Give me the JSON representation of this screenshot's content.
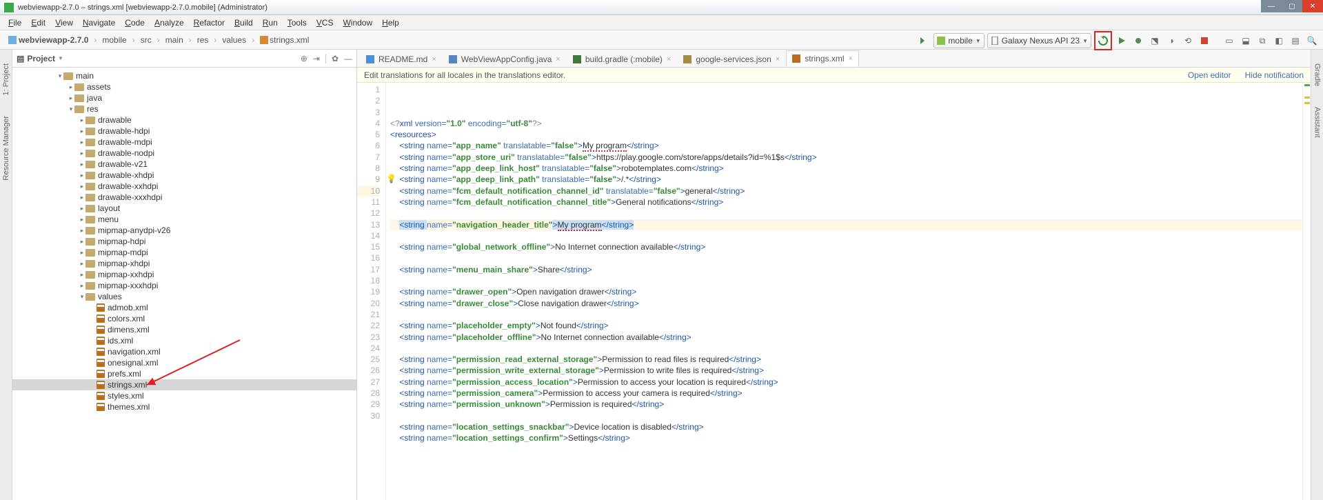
{
  "window": {
    "title": "webviewapp-2.7.0 – strings.xml [webviewapp-2.7.0.mobile] (Administrator)"
  },
  "menu": [
    "File",
    "Edit",
    "View",
    "Navigate",
    "Code",
    "Analyze",
    "Refactor",
    "Build",
    "Run",
    "Tools",
    "VCS",
    "Window",
    "Help"
  ],
  "breadcrumb": [
    "webviewapp-2.7.0",
    "mobile",
    "src",
    "main",
    "res",
    "values",
    "strings.xml"
  ],
  "run_config": {
    "module": "mobile",
    "device": "Galaxy Nexus API 23"
  },
  "project_header": {
    "label": "Project"
  },
  "tree": [
    {
      "d": 4,
      "tw": "▾",
      "k": "folder",
      "t": "main"
    },
    {
      "d": 5,
      "tw": "▸",
      "k": "folder",
      "t": "assets"
    },
    {
      "d": 5,
      "tw": "▸",
      "k": "folder",
      "t": "java"
    },
    {
      "d": 5,
      "tw": "▾",
      "k": "folder",
      "t": "res"
    },
    {
      "d": 6,
      "tw": "▸",
      "k": "folder",
      "t": "drawable"
    },
    {
      "d": 6,
      "tw": "▸",
      "k": "folder",
      "t": "drawable-hdpi"
    },
    {
      "d": 6,
      "tw": "▸",
      "k": "folder",
      "t": "drawable-mdpi"
    },
    {
      "d": 6,
      "tw": "▸",
      "k": "folder",
      "t": "drawable-nodpi"
    },
    {
      "d": 6,
      "tw": "▸",
      "k": "folder",
      "t": "drawable-v21"
    },
    {
      "d": 6,
      "tw": "▸",
      "k": "folder",
      "t": "drawable-xhdpi"
    },
    {
      "d": 6,
      "tw": "▸",
      "k": "folder",
      "t": "drawable-xxhdpi"
    },
    {
      "d": 6,
      "tw": "▸",
      "k": "folder",
      "t": "drawable-xxxhdpi"
    },
    {
      "d": 6,
      "tw": "▸",
      "k": "folder",
      "t": "layout"
    },
    {
      "d": 6,
      "tw": "▸",
      "k": "folder",
      "t": "menu"
    },
    {
      "d": 6,
      "tw": "▸",
      "k": "folder",
      "t": "mipmap-anydpi-v26"
    },
    {
      "d": 6,
      "tw": "▸",
      "k": "folder",
      "t": "mipmap-hdpi"
    },
    {
      "d": 6,
      "tw": "▸",
      "k": "folder",
      "t": "mipmap-mdpi"
    },
    {
      "d": 6,
      "tw": "▸",
      "k": "folder",
      "t": "mipmap-xhdpi"
    },
    {
      "d": 6,
      "tw": "▸",
      "k": "folder",
      "t": "mipmap-xxhdpi"
    },
    {
      "d": 6,
      "tw": "▸",
      "k": "folder",
      "t": "mipmap-xxxhdpi"
    },
    {
      "d": 6,
      "tw": "▾",
      "k": "folder",
      "t": "values"
    },
    {
      "d": 7,
      "tw": "",
      "k": "xml",
      "t": "admob.xml"
    },
    {
      "d": 7,
      "tw": "",
      "k": "xml",
      "t": "colors.xml"
    },
    {
      "d": 7,
      "tw": "",
      "k": "xml",
      "t": "dimens.xml"
    },
    {
      "d": 7,
      "tw": "",
      "k": "xml",
      "t": "ids.xml"
    },
    {
      "d": 7,
      "tw": "",
      "k": "xml",
      "t": "navigation.xml"
    },
    {
      "d": 7,
      "tw": "",
      "k": "xml",
      "t": "onesignal.xml"
    },
    {
      "d": 7,
      "tw": "",
      "k": "xml",
      "t": "prefs.xml"
    },
    {
      "d": 7,
      "tw": "",
      "k": "xml",
      "t": "strings.xml",
      "sel": true
    },
    {
      "d": 7,
      "tw": "",
      "k": "xml",
      "t": "styles.xml"
    },
    {
      "d": 7,
      "tw": "",
      "k": "xml",
      "t": "themes.xml"
    }
  ],
  "tabs": [
    {
      "icon": "md",
      "label": "README.md"
    },
    {
      "icon": "java",
      "label": "WebViewAppConfig.java"
    },
    {
      "icon": "gradle",
      "label": "build.gradle (:mobile)"
    },
    {
      "icon": "json",
      "label": "google-services.json"
    },
    {
      "icon": "xml",
      "label": "strings.xml",
      "active": true
    }
  ],
  "notice": {
    "text": "Edit translations for all locales in the translations editor.",
    "open": "Open editor",
    "hide": "Hide notification"
  },
  "code": {
    "lines": [
      {
        "n": 1,
        "seg": [
          [
            "decl",
            "<?"
          ],
          [
            "tag",
            "xml "
          ],
          [
            "attr",
            "version="
          ],
          [
            "val",
            "\"1.0\" "
          ],
          [
            "attr",
            "encoding="
          ],
          [
            "val",
            "\"utf-8\""
          ],
          [
            "decl",
            "?>"
          ]
        ]
      },
      {
        "n": 2,
        "seg": [
          [
            "tag",
            "<resources>"
          ]
        ]
      },
      {
        "n": 3,
        "seg": [
          [
            "txt",
            "    "
          ],
          [
            "tag",
            "<string "
          ],
          [
            "attr",
            "name="
          ],
          [
            "val",
            "\"app_name\" "
          ],
          [
            "attr",
            "translatable="
          ],
          [
            "val",
            "\"false\""
          ],
          [
            "tag",
            ">"
          ],
          [
            "err",
            "My program"
          ],
          [
            "tag",
            "</string>"
          ]
        ]
      },
      {
        "n": 4,
        "seg": [
          [
            "txt",
            "    "
          ],
          [
            "tag",
            "<string "
          ],
          [
            "attr",
            "name="
          ],
          [
            "val",
            "\"app_store_uri\" "
          ],
          [
            "attr",
            "translatable="
          ],
          [
            "val",
            "\"false\""
          ],
          [
            "tag",
            ">"
          ],
          [
            "txt",
            "https://play.google.com/store/apps/details?id=%1$s"
          ],
          [
            "tag",
            "</string>"
          ]
        ]
      },
      {
        "n": 5,
        "seg": [
          [
            "txt",
            "    "
          ],
          [
            "tag",
            "<string "
          ],
          [
            "attr",
            "name="
          ],
          [
            "val",
            "\"app_deep_link_host\" "
          ],
          [
            "attr",
            "translatable="
          ],
          [
            "val",
            "\"false\""
          ],
          [
            "tag",
            ">"
          ],
          [
            "txt",
            "robotemplates.com"
          ],
          [
            "tag",
            "</string>"
          ]
        ]
      },
      {
        "n": 6,
        "seg": [
          [
            "txt",
            "    "
          ],
          [
            "tag",
            "<string "
          ],
          [
            "attr",
            "name="
          ],
          [
            "val",
            "\"app_deep_link_path\" "
          ],
          [
            "attr",
            "translatable="
          ],
          [
            "val",
            "\"false\""
          ],
          [
            "tag",
            ">"
          ],
          [
            "txt",
            "/.*"
          ],
          [
            "tag",
            "</string>"
          ]
        ]
      },
      {
        "n": 7,
        "seg": [
          [
            "txt",
            "    "
          ],
          [
            "tag",
            "<string "
          ],
          [
            "attr",
            "name="
          ],
          [
            "val",
            "\"fcm_default_notification_channel_id\" "
          ],
          [
            "attr",
            "translatable="
          ],
          [
            "val",
            "\"false\""
          ],
          [
            "tag",
            ">"
          ],
          [
            "txt",
            "general"
          ],
          [
            "tag",
            "</string>"
          ]
        ]
      },
      {
        "n": 8,
        "seg": [
          [
            "txt",
            "    "
          ],
          [
            "tag",
            "<string "
          ],
          [
            "attr",
            "name="
          ],
          [
            "val",
            "\"fcm_default_notification_channel_title\""
          ],
          [
            "tag",
            ">"
          ],
          [
            "txt",
            "General notifications"
          ],
          [
            "tag",
            "</string>"
          ]
        ]
      },
      {
        "n": 9,
        "seg": []
      },
      {
        "n": 10,
        "hl": true,
        "seg": [
          [
            "txt",
            "    "
          ],
          [
            "seltag",
            "<string "
          ],
          [
            "attr",
            "name="
          ],
          [
            "val",
            "\"navigation_header_title\""
          ],
          [
            "seltag",
            ">"
          ],
          [
            "selerr",
            "My program"
          ],
          [
            "seltag",
            "</string>"
          ]
        ]
      },
      {
        "n": 11,
        "seg": []
      },
      {
        "n": 12,
        "seg": [
          [
            "txt",
            "    "
          ],
          [
            "tag",
            "<string "
          ],
          [
            "attr",
            "name="
          ],
          [
            "val",
            "\"global_network_offline\""
          ],
          [
            "tag",
            ">"
          ],
          [
            "txt",
            "No Internet connection available"
          ],
          [
            "tag",
            "</string>"
          ]
        ]
      },
      {
        "n": 13,
        "seg": []
      },
      {
        "n": 14,
        "seg": [
          [
            "txt",
            "    "
          ],
          [
            "tag",
            "<string "
          ],
          [
            "attr",
            "name="
          ],
          [
            "val",
            "\"menu_main_share\""
          ],
          [
            "tag",
            ">"
          ],
          [
            "txt",
            "Share"
          ],
          [
            "tag",
            "</string>"
          ]
        ]
      },
      {
        "n": 15,
        "seg": []
      },
      {
        "n": 16,
        "seg": [
          [
            "txt",
            "    "
          ],
          [
            "tag",
            "<string "
          ],
          [
            "attr",
            "name="
          ],
          [
            "val",
            "\"drawer_open\""
          ],
          [
            "tag",
            ">"
          ],
          [
            "txt",
            "Open navigation drawer"
          ],
          [
            "tag",
            "</string>"
          ]
        ]
      },
      {
        "n": 17,
        "seg": [
          [
            "txt",
            "    "
          ],
          [
            "tag",
            "<string "
          ],
          [
            "attr",
            "name="
          ],
          [
            "val",
            "\"drawer_close\""
          ],
          [
            "tag",
            ">"
          ],
          [
            "txt",
            "Close navigation drawer"
          ],
          [
            "tag",
            "</string>"
          ]
        ]
      },
      {
        "n": 18,
        "seg": []
      },
      {
        "n": 19,
        "seg": [
          [
            "txt",
            "    "
          ],
          [
            "tag",
            "<string "
          ],
          [
            "attr",
            "name="
          ],
          [
            "val",
            "\"placeholder_empty\""
          ],
          [
            "tag",
            ">"
          ],
          [
            "txt",
            "Not found"
          ],
          [
            "tag",
            "</string>"
          ]
        ]
      },
      {
        "n": 20,
        "seg": [
          [
            "txt",
            "    "
          ],
          [
            "tag",
            "<string "
          ],
          [
            "attr",
            "name="
          ],
          [
            "val",
            "\"placeholder_offline\""
          ],
          [
            "tag",
            ">"
          ],
          [
            "txt",
            "No Internet connection available"
          ],
          [
            "tag",
            "</string>"
          ]
        ]
      },
      {
        "n": 21,
        "seg": []
      },
      {
        "n": 22,
        "seg": [
          [
            "txt",
            "    "
          ],
          [
            "tag",
            "<string "
          ],
          [
            "attr",
            "name="
          ],
          [
            "val",
            "\"permission_read_external_storage\""
          ],
          [
            "tag",
            ">"
          ],
          [
            "txt",
            "Permission to read files is required"
          ],
          [
            "tag",
            "</string>"
          ]
        ]
      },
      {
        "n": 23,
        "seg": [
          [
            "txt",
            "    "
          ],
          [
            "tag",
            "<string "
          ],
          [
            "attr",
            "name="
          ],
          [
            "val",
            "\"permission_write_external_storage\""
          ],
          [
            "tag",
            ">"
          ],
          [
            "txt",
            "Permission to write files is required"
          ],
          [
            "tag",
            "</string>"
          ]
        ]
      },
      {
        "n": 24,
        "seg": [
          [
            "txt",
            "    "
          ],
          [
            "tag",
            "<string "
          ],
          [
            "attr",
            "name="
          ],
          [
            "val",
            "\"permission_access_location\""
          ],
          [
            "tag",
            ">"
          ],
          [
            "txt",
            "Permission to access your location is required"
          ],
          [
            "tag",
            "</string>"
          ]
        ]
      },
      {
        "n": 25,
        "seg": [
          [
            "txt",
            "    "
          ],
          [
            "tag",
            "<string "
          ],
          [
            "attr",
            "name="
          ],
          [
            "val",
            "\"permission_camera\""
          ],
          [
            "tag",
            ">"
          ],
          [
            "txt",
            "Permission to access your camera is required"
          ],
          [
            "tag",
            "</string>"
          ]
        ]
      },
      {
        "n": 26,
        "seg": [
          [
            "txt",
            "    "
          ],
          [
            "tag",
            "<string "
          ],
          [
            "attr",
            "name="
          ],
          [
            "val",
            "\"permission_unknown\""
          ],
          [
            "tag",
            ">"
          ],
          [
            "txt",
            "Permission is required"
          ],
          [
            "tag",
            "</string>"
          ]
        ]
      },
      {
        "n": 27,
        "seg": []
      },
      {
        "n": 28,
        "seg": [
          [
            "txt",
            "    "
          ],
          [
            "tag",
            "<string "
          ],
          [
            "attr",
            "name="
          ],
          [
            "val",
            "\"location_settings_snackbar\""
          ],
          [
            "tag",
            ">"
          ],
          [
            "txt",
            "Device location is disabled"
          ],
          [
            "tag",
            "</string>"
          ]
        ]
      },
      {
        "n": 29,
        "seg": [
          [
            "txt",
            "    "
          ],
          [
            "tag",
            "<string "
          ],
          [
            "attr",
            "name="
          ],
          [
            "val",
            "\"location_settings_confirm\""
          ],
          [
            "tag",
            ">"
          ],
          [
            "txt",
            "Settings"
          ],
          [
            "tag",
            "</string>"
          ]
        ]
      },
      {
        "n": 30,
        "seg": []
      }
    ]
  },
  "gutter_left": [
    "1: Project",
    "Resource Manager"
  ],
  "gutter_right": [
    "Gradle",
    "Assistant"
  ]
}
